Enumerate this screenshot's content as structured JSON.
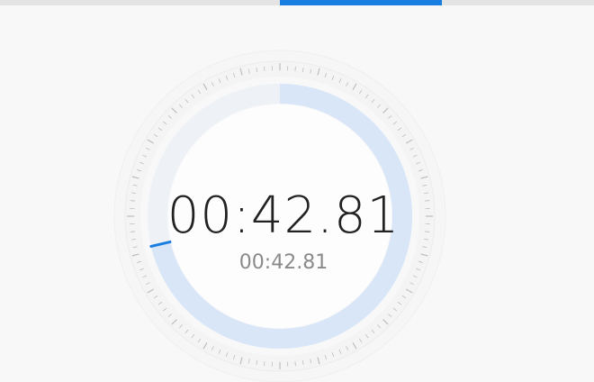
{
  "tabs": {
    "active_index": 2
  },
  "stopwatch": {
    "elapsed": "00:42.81",
    "lap_time": "00:42.81",
    "seconds_progress": 0.7135
  },
  "colors": {
    "accent": "#1a7ee0",
    "progress_fill": "#d8e6f8",
    "tick": "#bdbdbd",
    "background": "#f8f8f8"
  }
}
